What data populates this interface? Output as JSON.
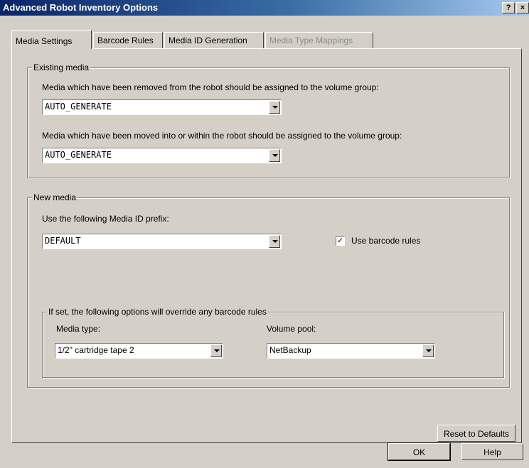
{
  "window": {
    "title": "Advanced Robot Inventory Options",
    "help_button": "?",
    "close_button": "×"
  },
  "tabs": [
    {
      "label": "Media Settings",
      "state": "active"
    },
    {
      "label": "Barcode Rules",
      "state": "normal"
    },
    {
      "label": "Media ID Generation",
      "state": "normal"
    },
    {
      "label": "Media Type Mappings",
      "state": "disabled"
    }
  ],
  "existing_media": {
    "legend": "Existing media",
    "removed_label": "Media which have been removed from the robot should be assigned to the volume group:",
    "removed_value": "AUTO_GENERATE",
    "moved_label": "Media which have been moved into or within the robot should be assigned to the volume group:",
    "moved_value": "AUTO_GENERATE"
  },
  "new_media": {
    "legend": "New media",
    "prefix_label": "Use the following Media ID prefix:",
    "prefix_value": "DEFAULT",
    "use_barcode_rules_label": "Use barcode rules",
    "use_barcode_rules_checked": true,
    "override": {
      "legend": "If set, the following options will override any barcode rules",
      "media_type_label": "Media type:",
      "media_type_value": "1/2\" cartridge tape 2",
      "volume_pool_label": "Volume pool:",
      "volume_pool_value": "NetBackup"
    }
  },
  "buttons": {
    "reset": "Reset to Defaults",
    "ok": "OK",
    "help": "Help"
  }
}
